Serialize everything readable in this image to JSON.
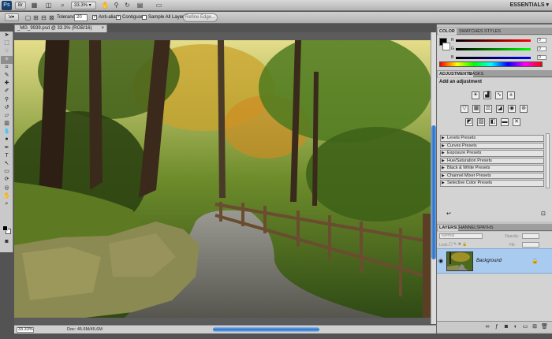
{
  "menubar": {
    "app_badge": "Ps",
    "zoom_value": "33.3%",
    "workspace": "ESSENTIALS ▾"
  },
  "options": {
    "tolerance_label": "Tolerance:",
    "tolerance_value": "20",
    "anti_alias_label": "Anti-alias",
    "contiguous_label": "Contiguous",
    "sample_all_label": "Sample All Layers",
    "refine_label": "Refine Edge..."
  },
  "document": {
    "tab_title": "_MG_9939.psd @ 33.3% (RGB/16)",
    "close": "×",
    "status_zoom": "33.33%",
    "status_doc": "Doc: 45.6M/45.6M"
  },
  "color_panel": {
    "tabs": [
      "COLOR",
      "SWATCHES",
      "STYLES"
    ],
    "channels": [
      "R",
      "G",
      "B"
    ],
    "values": [
      "0",
      "0",
      "0"
    ]
  },
  "adjustments_panel": {
    "tabs": [
      "ADJUSTMENTS",
      "MASKS"
    ],
    "heading": "Add an adjustment",
    "presets": [
      "Levels Presets",
      "Curves Presets",
      "Exposure Presets",
      "Hue/Saturation Presets",
      "Black & White Presets",
      "Channel Mixer Presets",
      "Selective Color Presets"
    ]
  },
  "layers_panel": {
    "tabs": [
      "LAYERS",
      "CHANNELS",
      "PATHS"
    ],
    "blend_mode": "Normal",
    "opacity_label": "Opacity:",
    "lock_label": "Lock:",
    "fill_label": "Fill:",
    "layer_name": "Background"
  },
  "colors": {
    "accent_blue": "#2c6cc4",
    "selected_layer": "#a9cbef"
  }
}
